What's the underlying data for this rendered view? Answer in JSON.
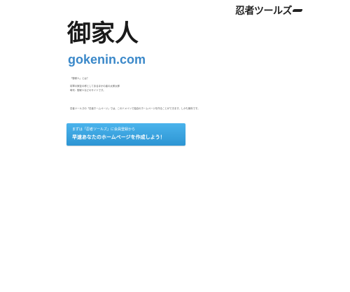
{
  "header": {
    "logo_text": "忍者ツールズ"
  },
  "main": {
    "site_title": "御家人",
    "domain": "gokenin.com"
  },
  "info": {
    "question": "「御家人」とは？",
    "answer_line1": "将軍の家臣の称としてあるほかの者の太郎太郎",
    "answer_line2": "時代：御家人などのサイトです。",
    "note": "忍者ツールズの「忍者ホームページ」では、このドメインで独自のホームページを作ることができます。しかも無料です。"
  },
  "banner": {
    "line1": "まずは「忍者ツールズ」に会員登録から",
    "line2": "早速あなたのホームページを作成しよう！",
    "color": "#3aa3e0"
  },
  "colors": {
    "domain": "#3a88c9",
    "title": "#1a1a1a"
  }
}
